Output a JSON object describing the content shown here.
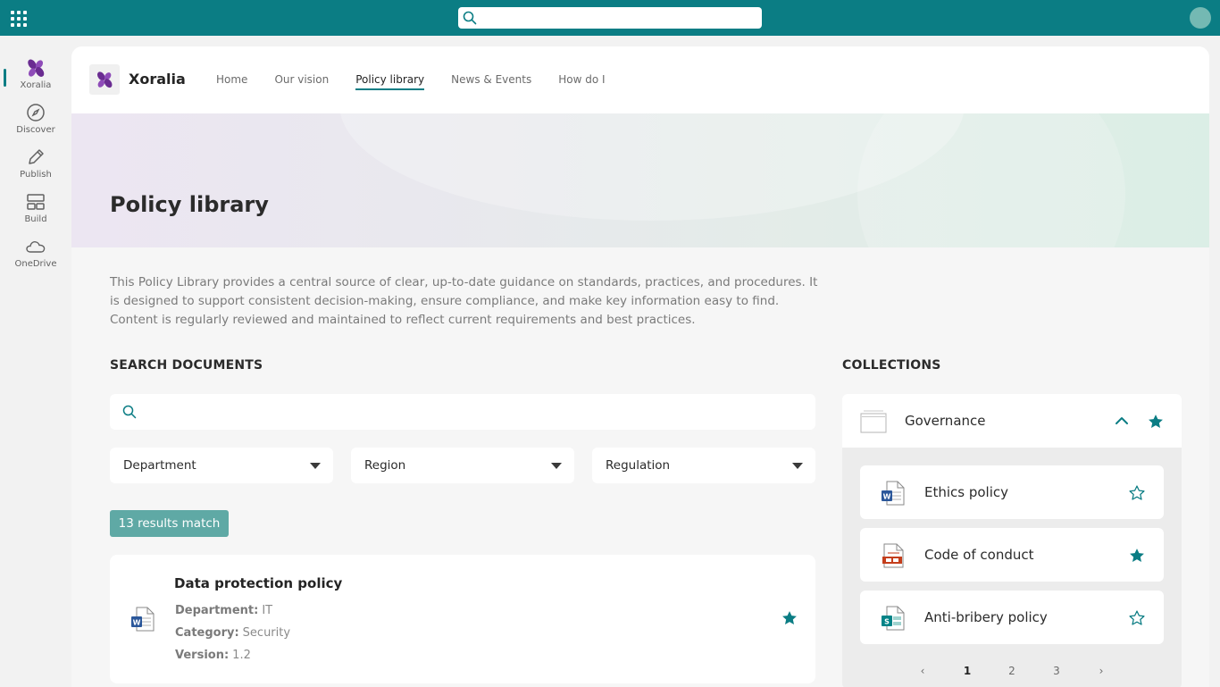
{
  "colors": {
    "brand": "#0b7d84",
    "accent_badge": "#5fa9a5",
    "star": "#0b7d84",
    "word": "#2b579a",
    "pdf": "#c43e1c",
    "sharepoint": "#038387"
  },
  "appbar": {
    "items": [
      {
        "label": "Xoralia",
        "icon": "xoralia-logo-icon",
        "active": true
      },
      {
        "label": "Discover",
        "icon": "compass-icon"
      },
      {
        "label": "Publish",
        "icon": "pen-icon"
      },
      {
        "label": "Build",
        "icon": "layout-icon"
      },
      {
        "label": "OneDrive",
        "icon": "cloud-icon"
      }
    ]
  },
  "site": {
    "name": "Xoralia",
    "nav": [
      {
        "label": "Home"
      },
      {
        "label": "Our vision"
      },
      {
        "label": "Policy library",
        "active": true
      },
      {
        "label": "News & Events"
      },
      {
        "label": "How do I"
      }
    ]
  },
  "hero": {
    "title": "Policy library"
  },
  "intro": "This Policy Library provides a central source of clear, up-to-date guidance on standards, practices, and procedures. It is designed to support consistent decision-making, ensure compliance, and make key information easy to find. Content is regularly reviewed and maintained to reflect current requirements and best practices.",
  "search": {
    "title": "SEARCH DOCUMENTS",
    "placeholder": "",
    "filters": [
      {
        "label": "Department"
      },
      {
        "label": "Region"
      },
      {
        "label": "Regulation"
      }
    ],
    "results_count": "13 results match",
    "results": [
      {
        "title": "Data protection policy",
        "file_type": "word-doc-icon",
        "favorite": true,
        "meta": [
          {
            "key": "Department:",
            "value": "IT"
          },
          {
            "key": "Category:",
            "value": "Security"
          },
          {
            "key": "Version:",
            "value": "1.2"
          }
        ]
      }
    ]
  },
  "collections": {
    "title": "COLLECTIONS",
    "group": {
      "name": "Governance",
      "expanded": true,
      "favorite": true
    },
    "items": [
      {
        "label": "Ethics policy",
        "file_type": "word-doc-icon",
        "favorite": false
      },
      {
        "label": "Code of conduct",
        "file_type": "pdf-doc-icon",
        "favorite": true
      },
      {
        "label": "Anti-bribery policy",
        "file_type": "sharepoint-page-icon",
        "favorite": false
      }
    ],
    "pager": {
      "prev": "‹",
      "pages": [
        "1",
        "2",
        "3"
      ],
      "current": "1",
      "next": "›"
    }
  }
}
